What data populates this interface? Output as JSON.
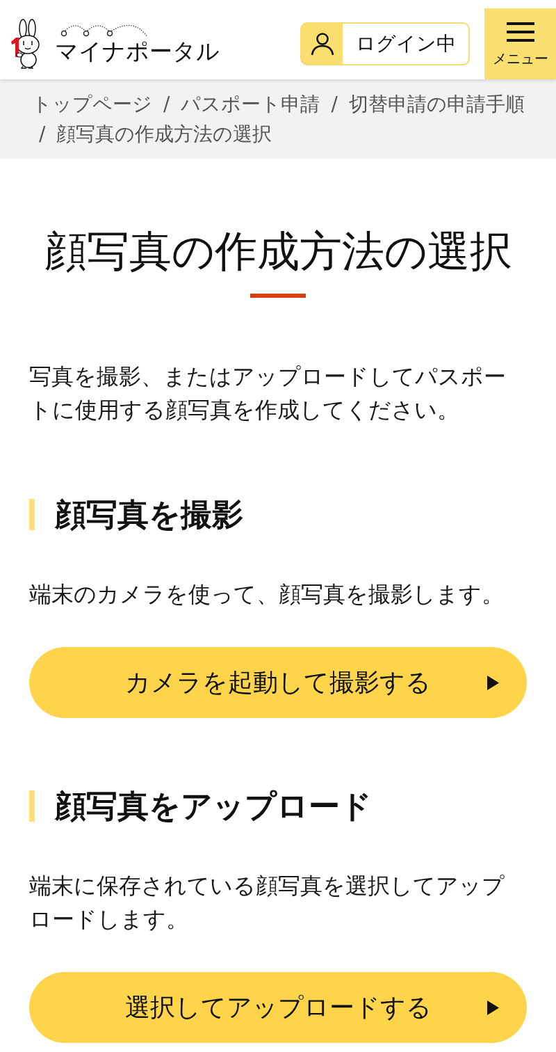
{
  "header": {
    "logo": "マイナポータル",
    "login_button": "ログイン中",
    "menu_button": "メニュー"
  },
  "breadcrumb": [
    {
      "label": "トップページ"
    },
    {
      "separator": "/",
      "label": "パスポート申請"
    },
    {
      "separator": "/",
      "label": "切替申請の申請手順"
    },
    {
      "separator": "/",
      "label": "顔写真の作成方法の選択"
    }
  ],
  "page_title": "顔写真の作成方法の選択",
  "intro": "写真を撮影、またはアップロードしてパスポートに使用する顔写真を作成してください。",
  "sections": [
    {
      "heading": "顔写真を撮影",
      "description": "端末のカメラを使って、顔写真を撮影します。",
      "button": "カメラを起動して撮影する"
    },
    {
      "heading": "顔写真をアップロード",
      "description": "端末に保存されている顔写真を選択してアップロードします。",
      "button": "選択してアップロードする"
    }
  ]
}
